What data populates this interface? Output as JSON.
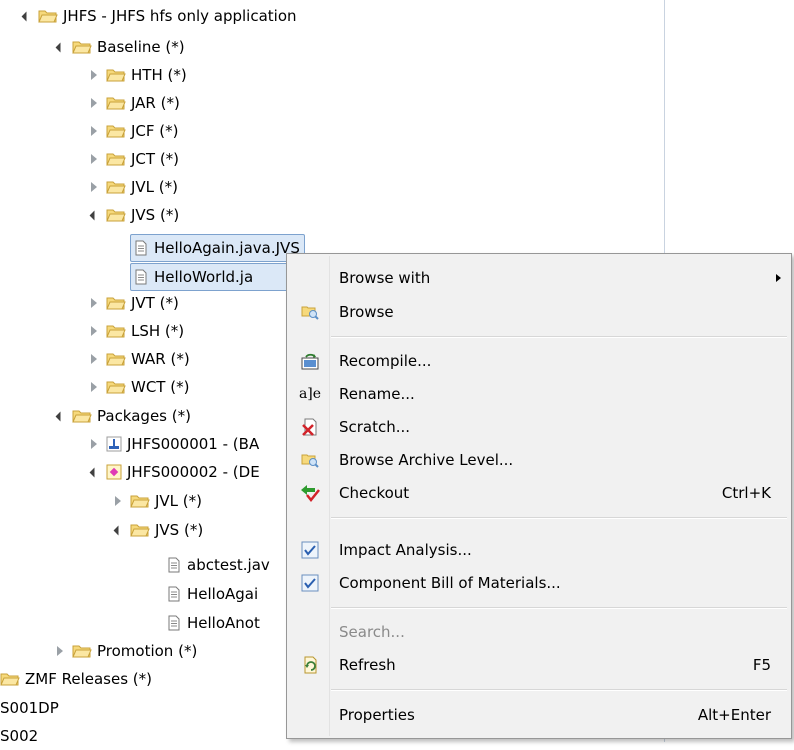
{
  "tree": {
    "root": "JHFS - JHFS hfs only application",
    "baseline": "Baseline (*)",
    "hth": "HTH (*)",
    "jar": "JAR (*)",
    "jcf": "JCF (*)",
    "jct": "JCT (*)",
    "jvl": "JVL (*)",
    "jvs": "JVS (*)",
    "file1": "HelloAgain.java.JVS",
    "file2": "HelloWorld.ja",
    "jvt": "JVT (*)",
    "lsh": "LSH (*)",
    "war": "WAR (*)",
    "wct": "WCT (*)",
    "packages": "Packages (*)",
    "pkg1": "JHFS000001 - (BA",
    "pkg2": "JHFS000002 - (DE",
    "pkg_jvl": "JVL (*)",
    "pkg_jvs": "JVS (*)",
    "pfile1": "abctest.jav",
    "pfile2": "HelloAgai",
    "pfile3": "HelloAnot",
    "promotion": "Promotion (*)",
    "zmf": "ZMF Releases (*)",
    "s001": "S001DP",
    "s002": "S002"
  },
  "menu": {
    "browse_with": "Browse with",
    "browse": "Browse",
    "recompile": "Recompile...",
    "rename_icon_text": "a]e",
    "rename": "Rename...",
    "scratch": "Scratch...",
    "browse_archive": "Browse Archive Level...",
    "checkout": "Checkout",
    "checkout_key": "Ctrl+K",
    "impact": "Impact Analysis...",
    "bom": "Component Bill of Materials...",
    "search": "Search...",
    "refresh": "Refresh",
    "refresh_key": "F5",
    "properties": "Properties",
    "properties_key": "Alt+Enter"
  },
  "colors": {
    "folder": "#e8c15a",
    "selection": "#dbe8f7",
    "menu_bg": "#f1f1f1"
  }
}
